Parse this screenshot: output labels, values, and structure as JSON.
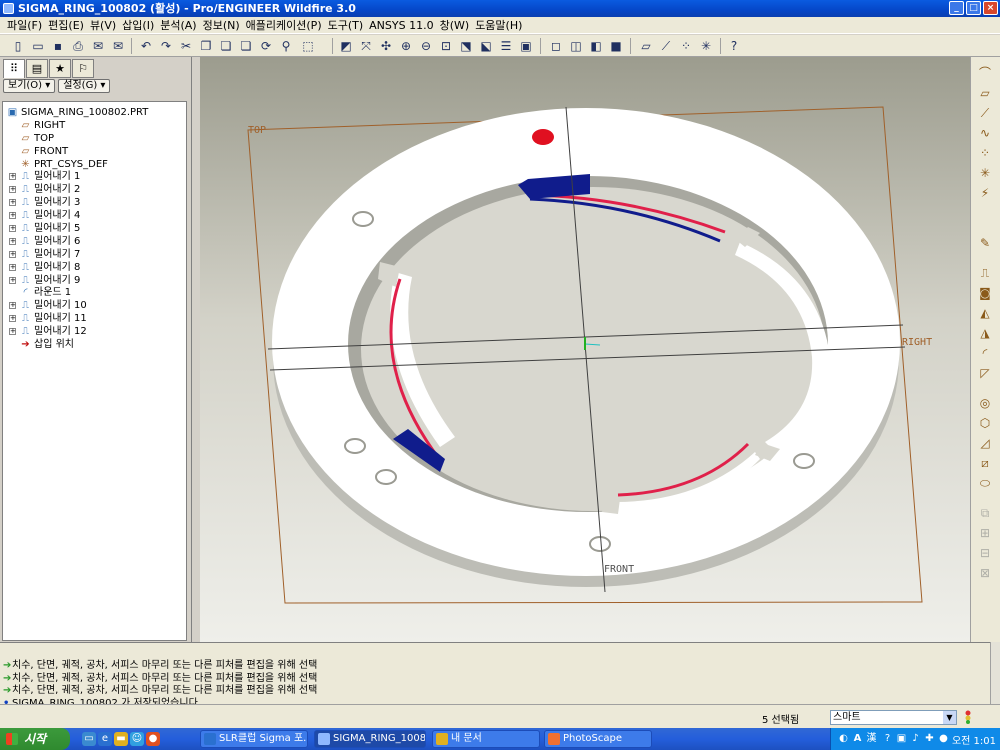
{
  "window": {
    "title": "SIGMA_RING_100802 (활성) - Pro/ENGINEER Wildfire 3.0",
    "buttons": {
      "minimize": "_",
      "maximize": "□",
      "close": "×"
    }
  },
  "menu": [
    "파일(F)",
    "편집(E)",
    "뷰(V)",
    "삽입(I)",
    "분석(A)",
    "정보(N)",
    "애플리케이션(P)",
    "도구(T)",
    "ANSYS 11.0",
    "창(W)",
    "도움말(H)"
  ],
  "panel": {
    "show_button": "보기(O) ▾",
    "settings_button": "설정(G) ▾"
  },
  "tree": {
    "root": "SIGMA_RING_100802.PRT",
    "items": [
      {
        "label": "RIGHT",
        "icon": "datum-plane-icon",
        "expand": false
      },
      {
        "label": "TOP",
        "icon": "datum-plane-icon",
        "expand": false
      },
      {
        "label": "FRONT",
        "icon": "datum-plane-icon",
        "expand": false
      },
      {
        "label": "PRT_CSYS_DEF",
        "icon": "csys-icon",
        "expand": false
      },
      {
        "label": "밀어내기 1",
        "icon": "extrude-icon",
        "expand": true
      },
      {
        "label": "밀어내기 2",
        "icon": "extrude-icon",
        "expand": true
      },
      {
        "label": "밀어내기 3",
        "icon": "extrude-icon",
        "expand": true
      },
      {
        "label": "밀어내기 4",
        "icon": "extrude-icon",
        "expand": true
      },
      {
        "label": "밀어내기 5",
        "icon": "extrude-icon",
        "expand": true
      },
      {
        "label": "밀어내기 6",
        "icon": "extrude-icon",
        "expand": true
      },
      {
        "label": "밀어내기 7",
        "icon": "extrude-icon",
        "expand": true
      },
      {
        "label": "밀어내기 8",
        "icon": "extrude-icon",
        "expand": true
      },
      {
        "label": "밀어내기 9",
        "icon": "extrude-icon",
        "expand": true
      },
      {
        "label": "라운드 1",
        "icon": "round-icon",
        "expand": false
      },
      {
        "label": "밀어내기 10",
        "icon": "extrude-icon",
        "expand": true
      },
      {
        "label": "밀어내기 11",
        "icon": "extrude-icon",
        "expand": true
      },
      {
        "label": "밀어내기 12",
        "icon": "extrude-icon",
        "expand": true
      },
      {
        "label": "삽입 위치",
        "icon": "insert-arrow-icon",
        "expand": false
      }
    ]
  },
  "viewport": {
    "datum_labels": {
      "top": "TOP",
      "right": "RIGHT",
      "front": "FRONT"
    }
  },
  "messages": [
    {
      "icon": "arrow-icon",
      "text": "치수, 단면, 궤적, 공차, 서피스 마무리 또는 다른 피처를 편집을 위해 선택"
    },
    {
      "icon": "arrow-icon",
      "text": "치수, 단면, 궤적, 공차, 서피스 마무리 또는 다른 피처를 편집을 위해 선택"
    },
    {
      "icon": "arrow-icon",
      "text": "치수, 단면, 궤적, 공차, 서피스 마무리 또는 다른 피처를 편집을 위해 선택"
    },
    {
      "icon": "info-dot-icon",
      "text": "SIGMA_RING_100802 가 저장되었습니다."
    }
  ],
  "status": {
    "selected": "5 선택됨",
    "filter": "스마트"
  },
  "taskbar": {
    "start": "시작",
    "tasks": [
      "SLR클럽 Sigma 포...",
      "SIGMA_RING_1008...",
      "내 문서",
      "PhotoScape"
    ],
    "clock": "오전 1:01",
    "tray": [
      "A",
      "漢"
    ]
  },
  "colors": {
    "title_bar": "#0546c8",
    "part_surface": "#ffffff",
    "highlight_red": "#e0204a",
    "highlight_blue": "#101c8c",
    "datum_plane": "#a0602a"
  }
}
